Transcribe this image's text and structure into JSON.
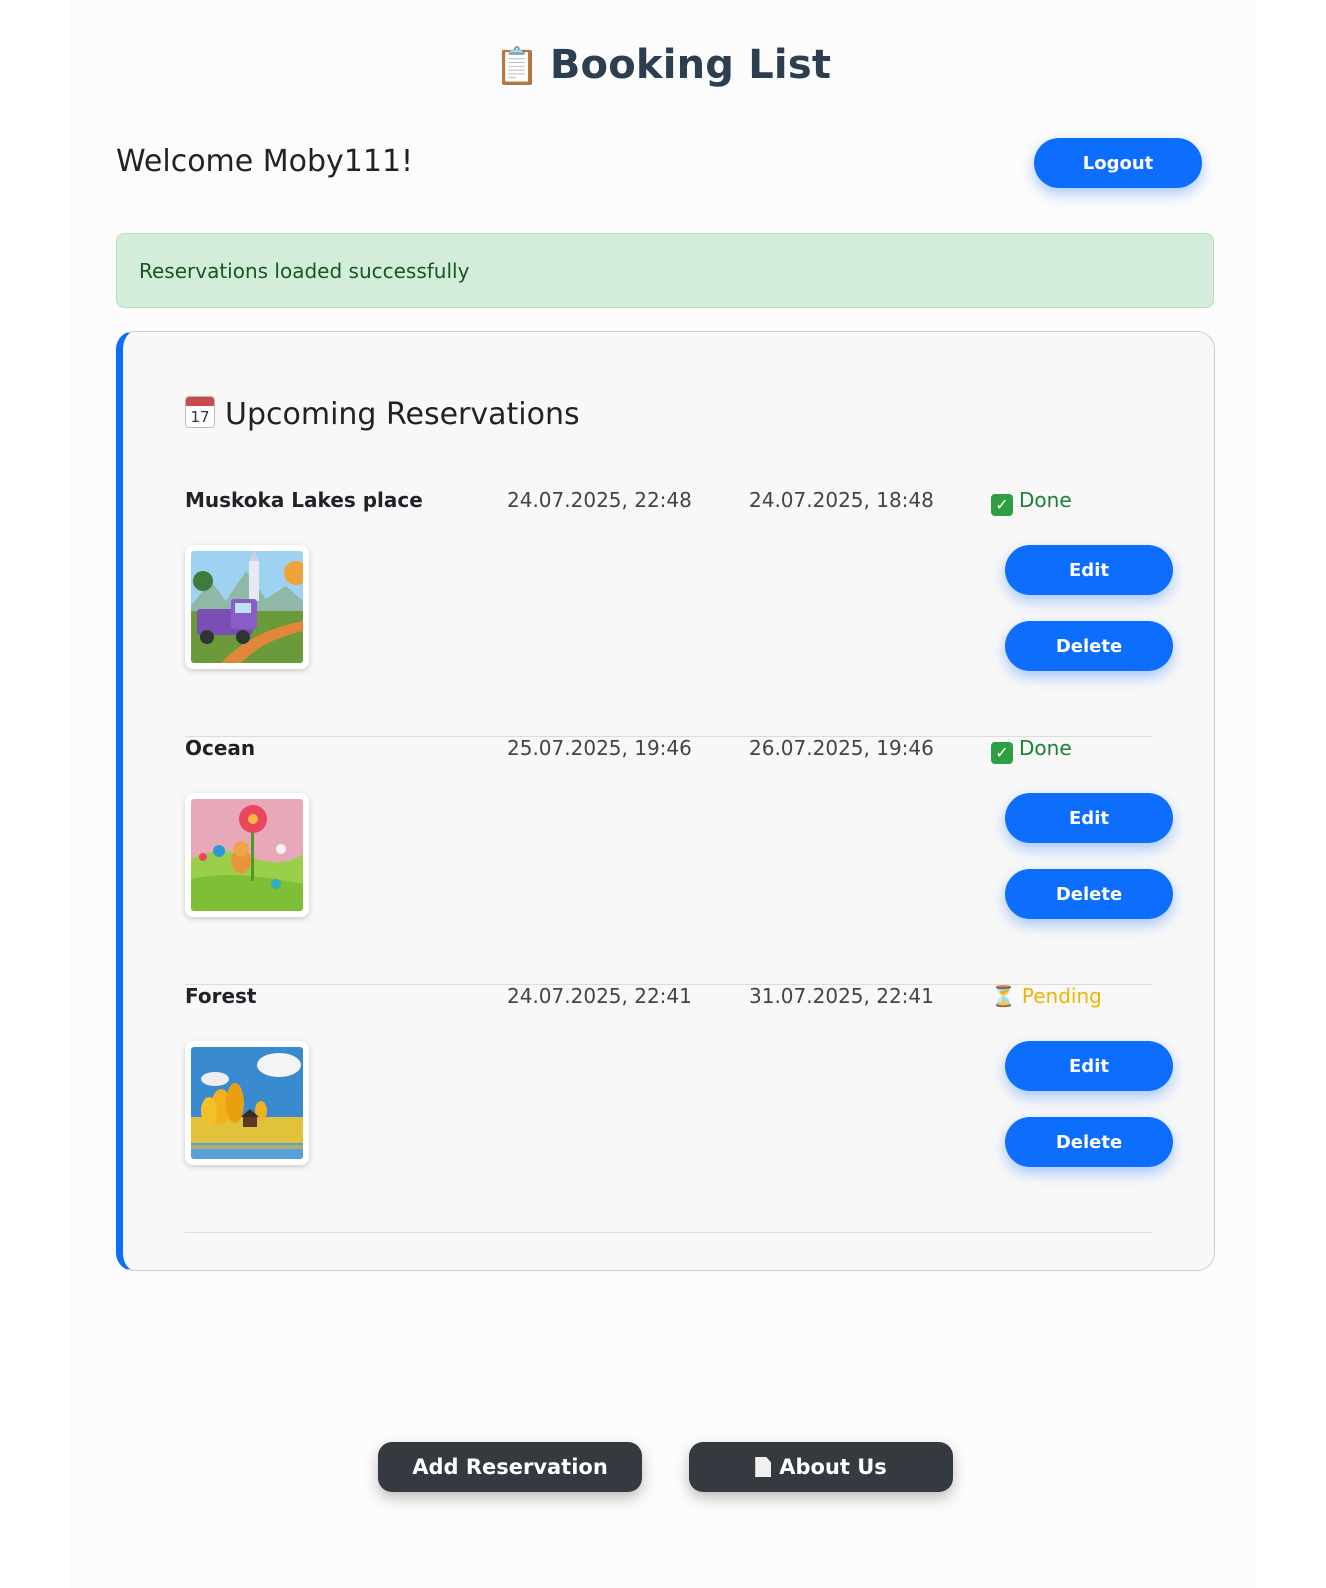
{
  "header": {
    "title": "Booking List",
    "title_icon": "clipboard-icon"
  },
  "welcome": "Welcome Moby111!",
  "logout_label": "Logout",
  "alert": {
    "message": "Reservations loaded successfully",
    "color": "#d4edda"
  },
  "section": {
    "title": "Upcoming Reservations",
    "icon": "calendar-icon",
    "icon_day": "17"
  },
  "reservations": [
    {
      "name": "Muskoka Lakes place",
      "start": "24.07.2025, 22:48",
      "end": "24.07.2025, 18:48",
      "status": "Done",
      "status_icon": "check-icon",
      "thumbnail": "purple-truck-landscape"
    },
    {
      "name": "Ocean",
      "start": "25.07.2025, 19:46",
      "end": "26.07.2025, 19:46",
      "status": "Done",
      "status_icon": "check-icon",
      "thumbnail": "flower-cat-meadow"
    },
    {
      "name": "Forest",
      "start": "24.07.2025, 22:41",
      "end": "31.07.2025, 22:41",
      "status": "Pending",
      "status_icon": "hourglass-icon",
      "thumbnail": "autumn-trees-lake"
    }
  ],
  "actions": {
    "edit_label": "Edit",
    "delete_label": "Delete"
  },
  "footer": {
    "add_label": "Add Reservation",
    "about_label": "About Us",
    "about_icon": "document-icon"
  },
  "colors": {
    "primary": "#0d6efd",
    "dark": "#343a40",
    "done": "#1a7f37",
    "pending": "#f0b400"
  }
}
